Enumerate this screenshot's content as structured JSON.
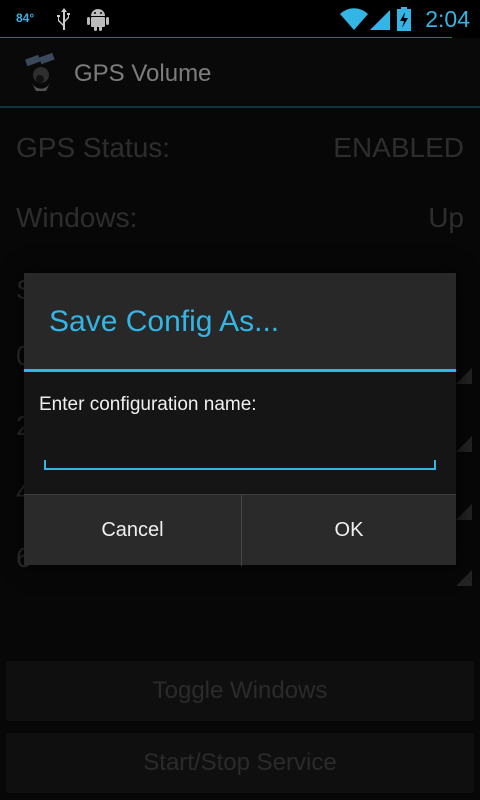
{
  "status_bar": {
    "temperature": "84°",
    "time": "2:04",
    "icons": [
      "usb-icon",
      "android-debug-icon",
      "wifi-icon",
      "signal-icon",
      "battery-charging-icon"
    ]
  },
  "action_bar": {
    "app_icon": "satellite-icon",
    "title": "GPS Volume"
  },
  "main": {
    "rows": [
      {
        "label": "GPS Status:",
        "value": "ENABLED"
      },
      {
        "label": "Windows:",
        "value": "Up"
      }
    ],
    "obscured_row_initials": [
      "S",
      "0",
      "2",
      "4",
      "6"
    ],
    "buttons": {
      "toggle_windows": "Toggle Windows",
      "start_stop_service": "Start/Stop Service"
    }
  },
  "dialog": {
    "title": "Save Config As...",
    "prompt": "Enter configuration name:",
    "input_value": "",
    "cancel_label": "Cancel",
    "ok_label": "OK"
  },
  "colors": {
    "accent": "#33b5e5",
    "background": "#0e0e0e",
    "dialog_bg": "#282828"
  }
}
